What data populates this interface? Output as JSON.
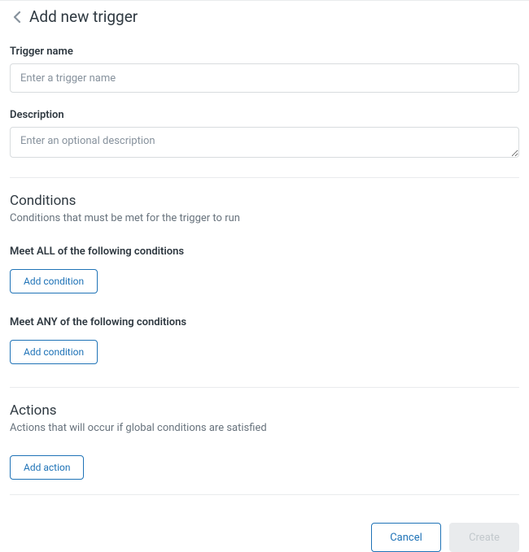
{
  "header": {
    "title": "Add new trigger"
  },
  "fields": {
    "trigger_name": {
      "label": "Trigger name",
      "placeholder": "Enter a trigger name",
      "value": ""
    },
    "description": {
      "label": "Description",
      "placeholder": "Enter an optional description",
      "value": ""
    }
  },
  "conditions": {
    "title": "Conditions",
    "subtitle": "Conditions that must be met for the trigger to run",
    "all": {
      "label": "Meet ALL of the following conditions",
      "add_button": "Add condition"
    },
    "any": {
      "label": "Meet ANY of the following conditions",
      "add_button": "Add condition"
    }
  },
  "actions": {
    "title": "Actions",
    "subtitle": "Actions that will occur if global conditions are satisfied",
    "add_button": "Add action"
  },
  "footer": {
    "cancel": "Cancel",
    "create": "Create"
  }
}
